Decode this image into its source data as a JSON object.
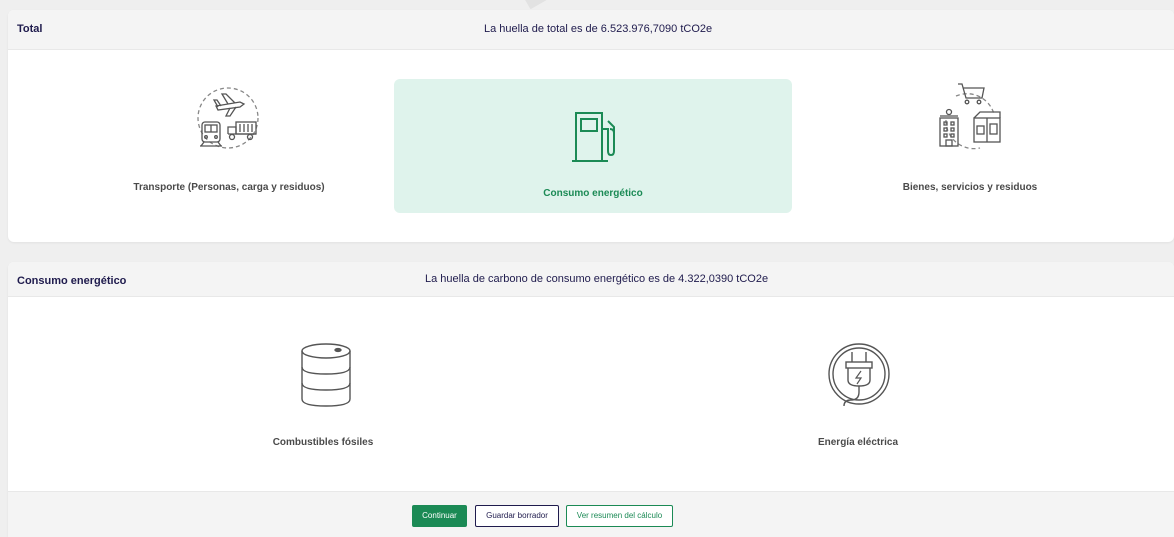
{
  "total_section": {
    "title": "Total",
    "message": "La huella de total es de 6.523.976,7090 tCO2e",
    "options": [
      {
        "label": "Transporte (Personas, carga y residuos)",
        "icon": "transport-icon",
        "selected": false
      },
      {
        "label": "Consumo energético",
        "icon": "fuel-pump-icon",
        "selected": true
      },
      {
        "label": "Bienes, servicios y residuos",
        "icon": "goods-services-icon",
        "selected": false
      }
    ]
  },
  "consumo_section": {
    "title": "Consumo energético",
    "message": "La huella de carbono de consumo energético es de 4.322,0390 tCO2e",
    "options": [
      {
        "label": "Combustibles fósiles",
        "icon": "oil-barrel-icon"
      },
      {
        "label": "Energía eléctrica",
        "icon": "electric-plug-icon"
      }
    ]
  },
  "footer": {
    "continuar_label": "Continuar",
    "guardar_label": "Guardar borrador",
    "resumen_label": "Ver resumen del cálculo"
  },
  "colors": {
    "accent_green": "#1b8a55",
    "selected_bg": "#dff3ec",
    "navy": "#1f1b4d",
    "header_bg": "#f4f4f4"
  }
}
